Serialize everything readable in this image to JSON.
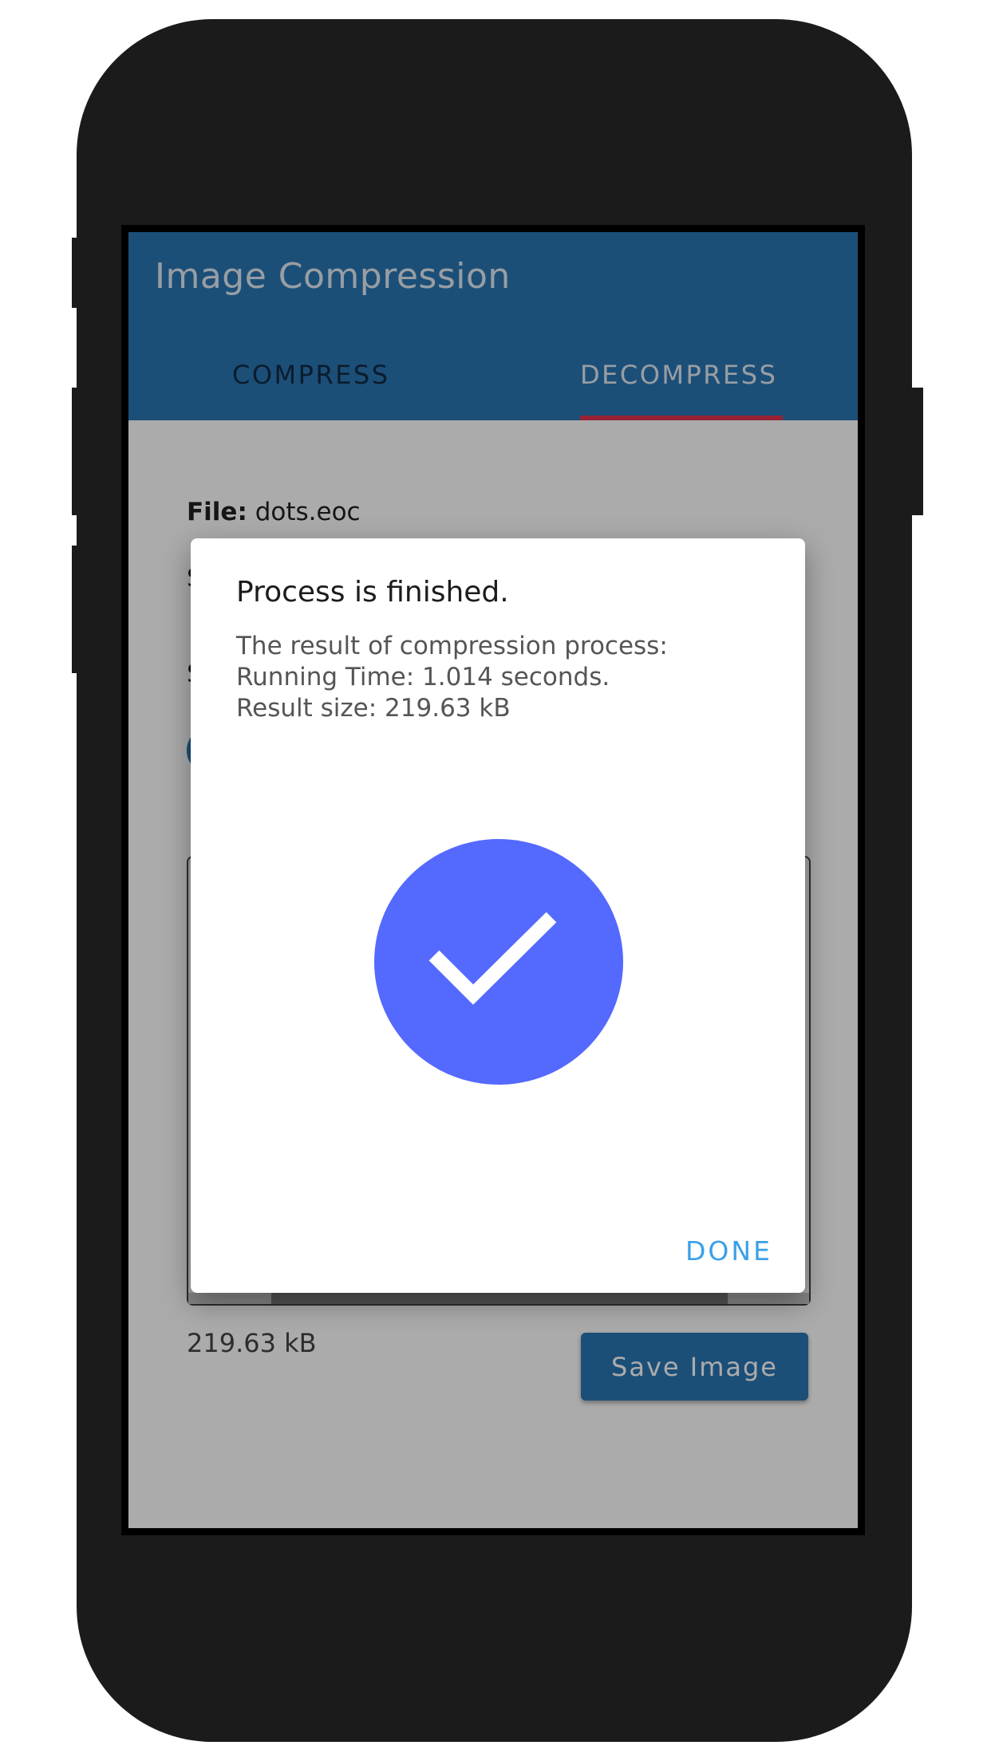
{
  "app": {
    "title": "Image Compression"
  },
  "tabs": [
    {
      "label": "COMPRESS",
      "selected": false
    },
    {
      "label": "DECOMPRESS",
      "selected": true
    }
  ],
  "content": {
    "file_label": "File:",
    "file_name": "dots.eoc",
    "size_label": "219.63 kB",
    "save_button": "Save Image"
  },
  "dialog": {
    "title": "Process is finished.",
    "lines": [
      "The result of compression process:",
      "Running Time: 1.014 seconds.",
      "Result size: 219.63 kB"
    ],
    "icon": "check-circle-icon",
    "done_button": "DONE"
  },
  "colors": {
    "app_bar": "#2a76b4",
    "tab_indicator": "#e0354f",
    "check_circle": "#5469fe",
    "done_text": "#3aa0e8"
  }
}
